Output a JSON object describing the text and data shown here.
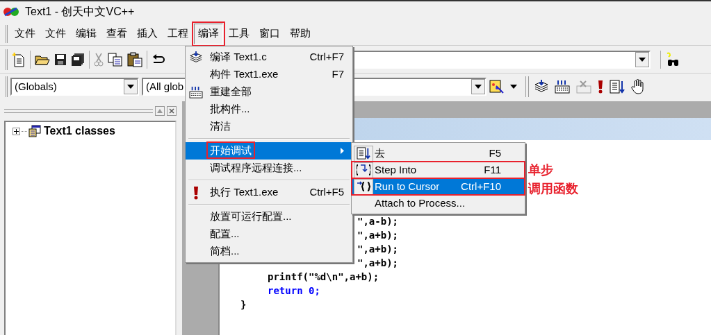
{
  "window": {
    "title": "Text1 - 创天中文VC++"
  },
  "menubar": [
    {
      "label": "文件",
      "selected": false,
      "annotated": false
    },
    {
      "label": "文件",
      "selected": false,
      "annotated": false
    },
    {
      "label": "编辑",
      "selected": false,
      "annotated": false
    },
    {
      "label": "查看",
      "selected": false,
      "annotated": false
    },
    {
      "label": "插入",
      "selected": false,
      "annotated": false
    },
    {
      "label": "工程",
      "selected": false,
      "annotated": false
    },
    {
      "label": "编译",
      "selected": true,
      "annotated": true
    },
    {
      "label": "工具",
      "selected": false,
      "annotated": false
    },
    {
      "label": "窗口",
      "selected": false,
      "annotated": false
    },
    {
      "label": "帮助",
      "selected": false,
      "annotated": false
    }
  ],
  "toolbar2": {
    "scope_combo": "(Globals)",
    "members_combo": "(All glob"
  },
  "class_view": {
    "tree": [
      {
        "label": "Text1 classes",
        "expanded": false
      }
    ]
  },
  "editor": {
    "lines": [
      {
        "kind": "fragment",
        "text": "\",a-b);"
      },
      {
        "kind": "fragment",
        "text": "\",a+b);"
      },
      {
        "kind": "fragment",
        "text": "\",a+b);"
      },
      {
        "kind": "fragment",
        "text": "\",a+b);"
      },
      {
        "kind": "body",
        "text": "printf(\"%d\\n\",a+b);"
      },
      {
        "kind": "return",
        "text": "return 0;"
      },
      {
        "kind": "close",
        "text": "}"
      }
    ]
  },
  "build_menu": {
    "items": [
      {
        "kind": "item",
        "label": "编译 Text1.c",
        "shortcut": "Ctrl+F7",
        "selected": false,
        "annotated": false
      },
      {
        "kind": "item",
        "label": "构件 Text1.exe",
        "shortcut": "F7",
        "selected": false,
        "annotated": false
      },
      {
        "kind": "item",
        "label": "重建全部",
        "selected": false,
        "annotated": false
      },
      {
        "kind": "item",
        "label": "批构件...",
        "selected": false,
        "annotated": false
      },
      {
        "kind": "item",
        "label": "清洁",
        "selected": false,
        "annotated": false
      },
      {
        "kind": "separator"
      },
      {
        "kind": "submenu",
        "label": "开始调试",
        "selected": true,
        "annotated": true
      },
      {
        "kind": "item",
        "label": "调试程序远程连接...",
        "selected": false,
        "annotated": false
      },
      {
        "kind": "separator"
      },
      {
        "kind": "item",
        "label": "执行 Text1.exe",
        "shortcut": "Ctrl+F5",
        "selected": false,
        "annotated": false
      },
      {
        "kind": "separator"
      },
      {
        "kind": "item",
        "label": "放置可运行配置...",
        "selected": false,
        "annotated": false
      },
      {
        "kind": "item",
        "label": "配置...",
        "selected": false,
        "annotated": false
      },
      {
        "kind": "item",
        "label": "简档...",
        "selected": false,
        "annotated": false
      }
    ]
  },
  "debug_submenu": {
    "items": [
      {
        "label": "去",
        "shortcut": "F5",
        "selected": false,
        "annotated": false
      },
      {
        "label": "Step Into",
        "shortcut": "F11",
        "selected": false,
        "annotated": true
      },
      {
        "label": "Run to Cursor",
        "shortcut": "Ctrl+F10",
        "selected": true,
        "annotated": true
      },
      {
        "label": "Attach to Process...",
        "selected": false,
        "annotated": false
      }
    ]
  },
  "annotations": [
    {
      "text": "单步"
    },
    {
      "text": "调用函数"
    }
  ]
}
